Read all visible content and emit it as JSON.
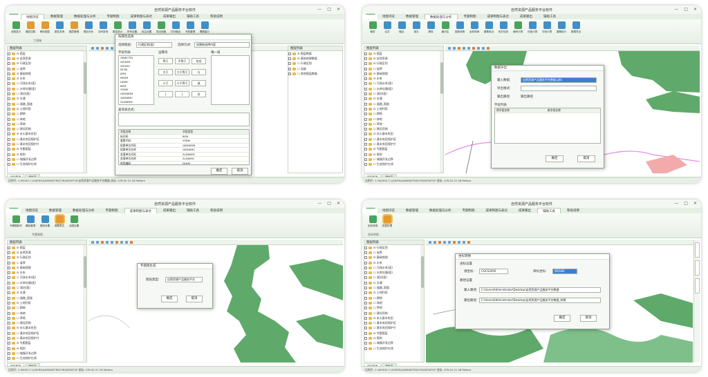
{
  "app_title": "自然资源产品服务平台软件",
  "window_controls": [
    "—",
    "□",
    "✕"
  ],
  "colors": {
    "accent": "#3aa04a",
    "map_green": "#5faa6a",
    "boundary_pink": "#e58be5",
    "selection_blue": "#3d7dd1"
  },
  "screens": [
    {
      "tabs": [
        "地图浏览",
        "数据管理",
        "数据处理与分析",
        "专题制图",
        "成果制图与表达",
        "成果输出",
        "辅助工具",
        "帮助说明"
      ],
      "active_tab": 0,
      "ribbon": [
        "全图显示",
        "图层加载",
        "移除图层",
        "属性查询",
        "图层管理",
        "叠加分析",
        "空间查询",
        "属性统计",
        "符号设置",
        "标注设置",
        "导出地图",
        "打印输出",
        "书签管理",
        "鹰眼窗口"
      ],
      "ribbon_group": "工具箱",
      "sidebar_title": "图层列表",
      "tree": [
        "⊟ 图层",
        "  ⊟ 自然资源",
        "    ⊟ 行政区划",
        "      ☐ 省界",
        "    ⊟ 基础地理",
        "      ⊟ 水系",
        "        ☐ 河流水系(面)",
        "        ☐ 水库坑塘(面)",
        "        ☐ 湖泊(面)",
        "      ⊟ 交通",
        "        ☐ 道路_国道",
        "    ⊟ 土地利用",
        "      ☐ 耕地",
        "      ☐ 林地",
        "      ☐ 草地",
        "      ☐ 建设用地",
        "    ⊟ 永久基本农田",
        "      ☐ 基本农田保护区",
        "      ☐ 基本农田保护片",
        "  ⊟ 专题图层",
        "    ⊟ 规划",
        "      ☐ 城镇开发边界",
        "      ☐ 生态保护红线"
      ],
      "bottom_tabs": [
        "图层管理",
        "属性表"
      ],
      "status": "比例尺: 1:90000   C:\\USERS\\ADMINISTRATOR\\DESKTOP\\自然资源产品服务平台数据   坐标: 476.00 21.36   Meters",
      "dialog": {
        "title": "按属性选择",
        "layer_label": "选择图层:",
        "layer_value": "行政区划(面)",
        "method_label": "选择方式:",
        "method_value": "创建新选择内容",
        "fields_label": "字段列表",
        "fields": [
          "OBJECTID",
          "XZQDM",
          "XZQMC",
          "DCMJ",
          "JSMJ",
          "MSSM",
          "HDMC",
          "BSM",
          "YSDM",
          "QSDWDM",
          "QSDWMC",
          "ZLDWDM"
        ],
        "ops_label": "运算符",
        "ops": [
          "等于",
          "不等于",
          "包含",
          "大于",
          "大于等于",
          "与",
          "小于",
          "小于等于",
          "或",
          "(",
          ")",
          "非"
        ],
        "unique_label": "唯一值",
        "expr_label": "查询表达式:",
        "table_headers": [
          "字段名称",
          "字段类型"
        ],
        "table_rows": [
          [
            "标识码",
            "BSM"
          ],
          [
            "要素代码",
            "YSDM"
          ],
          [
            "权属单位代码",
            "QSDWDM"
          ],
          [
            "权属单位名称",
            "QSDWMC"
          ],
          [
            "坐落单位代码",
            "ZLDWDM"
          ],
          [
            "坐落单位名称",
            "ZLDWMC"
          ],
          [
            "地类编码",
            "DLBM"
          ],
          [
            "地类名称",
            "DLMC"
          ]
        ],
        "ok": "确定",
        "cancel": "取消"
      },
      "right_panel_title": "图层列表",
      "right_tree": [
        "⊟ 图层数据",
        "  ⊟ 基础地理数据",
        "    ☐ 行政区划",
        "      ☐ 县级",
        "  ☐ 其他图层数据"
      ]
    },
    {
      "tabs": [
        "地图浏览",
        "数据管理",
        "数据处理与分析",
        "专题制图",
        "成果制图与表达",
        "成果输出",
        "辅助工具"
      ],
      "active_tab": 2,
      "ribbon": [
        "裁剪",
        "合并",
        "融合",
        "相交",
        "擦除",
        "缓冲区",
        "投影转换",
        "坐标转换",
        "要素转点",
        "拓扑检查",
        "面积计算",
        "长度计算",
        "字段计算",
        "要素统计",
        "数据导出"
      ],
      "status": "比例尺: 1:180000   C:\\USERS\\ADMINISTRATOR\\DESKTOP   坐标: 476.00 21.36 Meters",
      "dialog": {
        "title": "数据导出",
        "source_label": "输入数据:",
        "source_value": "自然资源产品服务平台数据.gdb",
        "target_label": "导出格式:",
        "path_label": "输出路径:",
        "path_value": "输出路径",
        "list_title": "字段列表",
        "list_headers": [
          "原字段名称",
          "新字段名称"
        ],
        "ok": "确定",
        "cancel": "取消"
      }
    },
    {
      "tabs": [
        "地图浏览",
        "数据管理",
        "数据处理与分析",
        "专题制图",
        "成果制图与表达",
        "成果输出",
        "辅助工具",
        "帮助说明"
      ],
      "active_tab": 4,
      "ribbon": [
        "专题图制作",
        "模板管理",
        "图例设置",
        "制图表达",
        "出图设置"
      ],
      "ribbon_group": "专题制图",
      "status": "比例尺: 1:90000   C:\\USERS\\ADMINISTRATOR\\DESKTOP   坐标: 476.00 21.36 Meters",
      "dialog": {
        "title": "专题图生成",
        "type_label": "图层类型:",
        "type_value": "自然资源产品服务平台",
        "ok": "确定",
        "cancel": "取消"
      }
    },
    {
      "tabs": [
        "地图浏览",
        "数据管理",
        "数据处理与分析",
        "专题制图",
        "成果制图与表达",
        "成果输出",
        "辅助工具",
        "帮助说明"
      ],
      "active_tab": 6,
      "ribbon": [
        "坐标转换",
        "批量处理"
      ],
      "ribbon_group": "坐标转换",
      "status": "比例尺: 1:180000   C:\\USERS\\ADMINISTRATOR\\DESKTOP   坐标: 476.00 21.36 Meters",
      "dialog": {
        "title": "坐标转换",
        "section1": "坐标设置",
        "source_label": "源坐标:",
        "source_value": "CGCS2000",
        "target_label": "目标坐标:",
        "target_value": "WGS84",
        "section2": "路径设置",
        "input_label": "输入路径:",
        "input_value": "C:\\Users\\Administrator\\Desktop\\自然资源产品服务平台数据",
        "output_label": "输出路径:",
        "output_value": "C:\\Users\\Administrator\\Desktop\\自然资源产品服务平台数据_转换",
        "ok": "确定",
        "cancel": "取消"
      }
    }
  ]
}
